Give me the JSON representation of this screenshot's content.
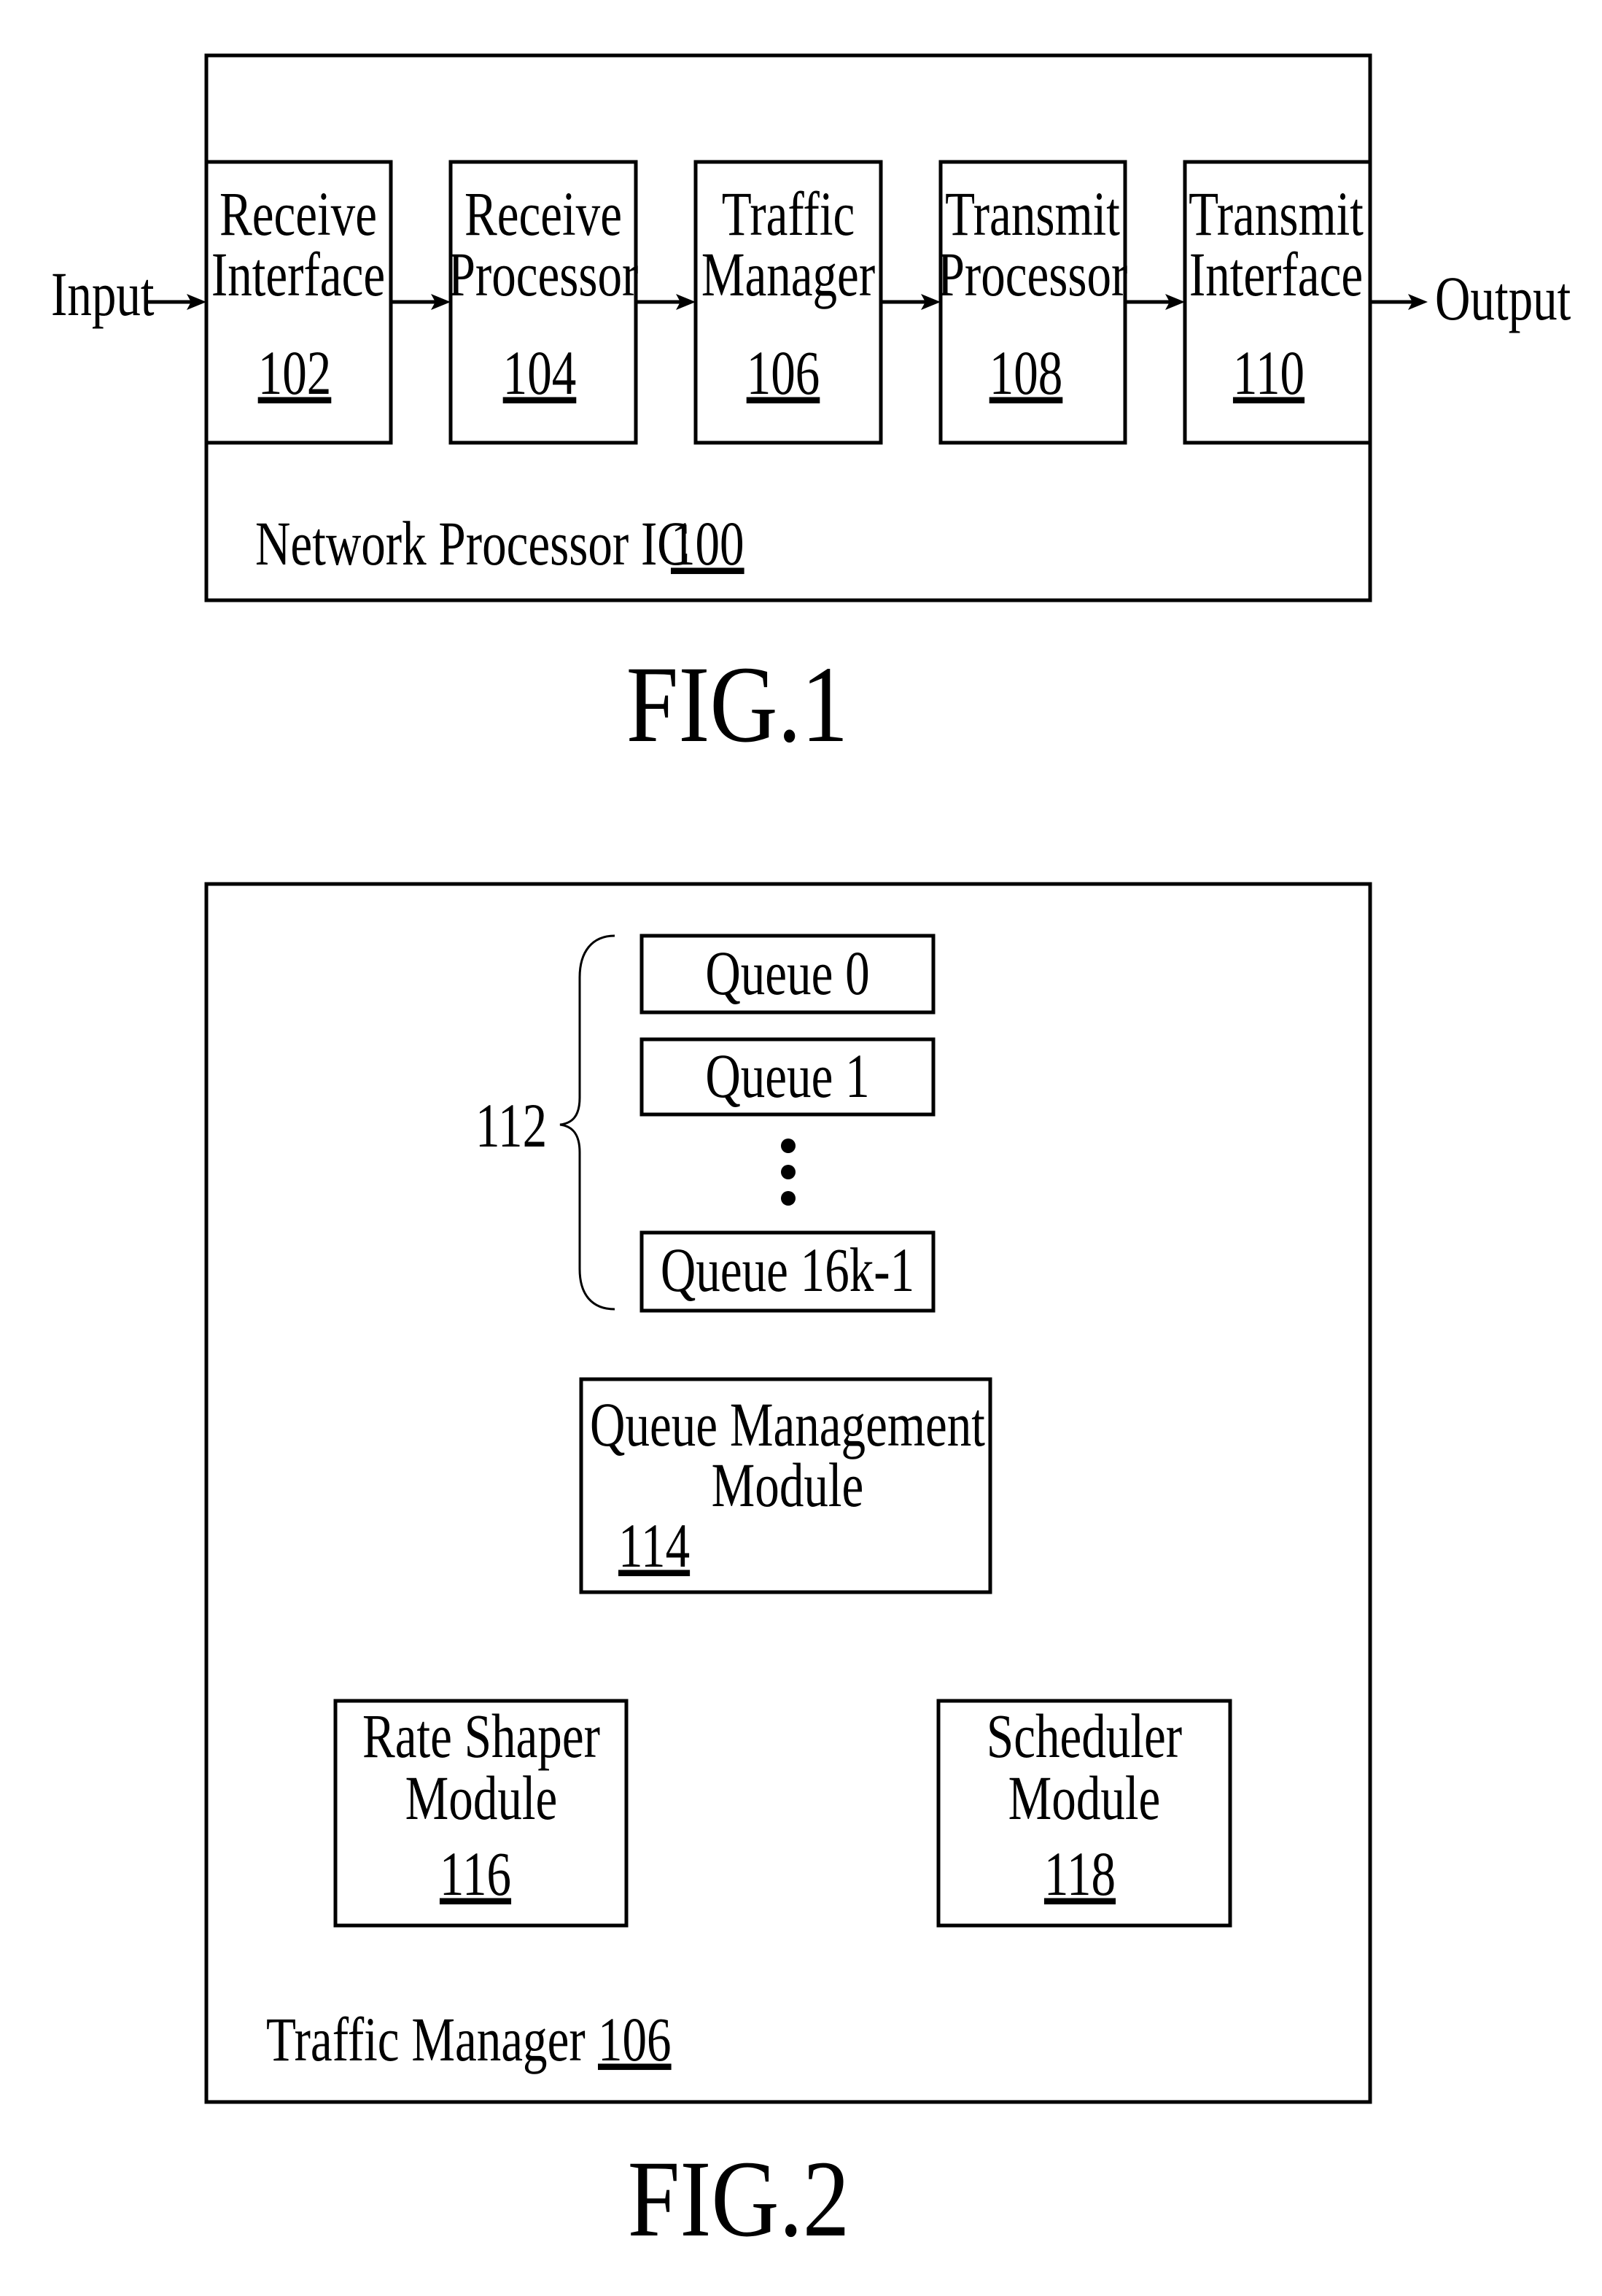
{
  "fig1": {
    "caption": "FIG.1",
    "input_label": "Input",
    "output_label": "Output",
    "container": {
      "name": "Network Processor IC",
      "ref": "100"
    },
    "blocks": [
      {
        "line1": "Receive",
        "line2": "Interface",
        "ref": "102"
      },
      {
        "line1": "Receive",
        "line2": "Processor",
        "ref": "104"
      },
      {
        "line1": "Traffic",
        "line2": "Manager",
        "ref": "106"
      },
      {
        "line1": "Transmit",
        "line2": "Processor",
        "ref": "108"
      },
      {
        "line1": "Transmit",
        "line2": "Interface",
        "ref": "110"
      }
    ],
    "connections": [
      {
        "from": "Input",
        "to": "102"
      },
      {
        "from": "102",
        "to": "104"
      },
      {
        "from": "104",
        "to": "106"
      },
      {
        "from": "106",
        "to": "108"
      },
      {
        "from": "108",
        "to": "110"
      },
      {
        "from": "110",
        "to": "Output"
      }
    ]
  },
  "fig2": {
    "caption": "FIG.2",
    "container": {
      "name": "Traffic Manager",
      "ref": "106"
    },
    "queue_group": {
      "ref": "112",
      "queues": [
        "Queue 0",
        "Queue 1",
        "Queue 16k-1"
      ],
      "ellipsis": "vertical-ellipsis"
    },
    "modules": [
      {
        "id": "qmm",
        "line1": "Queue Management",
        "line2": "Module",
        "ref": "114"
      },
      {
        "id": "rsm",
        "line1": "Rate Shaper",
        "line2": "Module",
        "ref": "116"
      },
      {
        "id": "sch",
        "line1": "Scheduler",
        "line2": "Module",
        "ref": "118"
      }
    ]
  }
}
